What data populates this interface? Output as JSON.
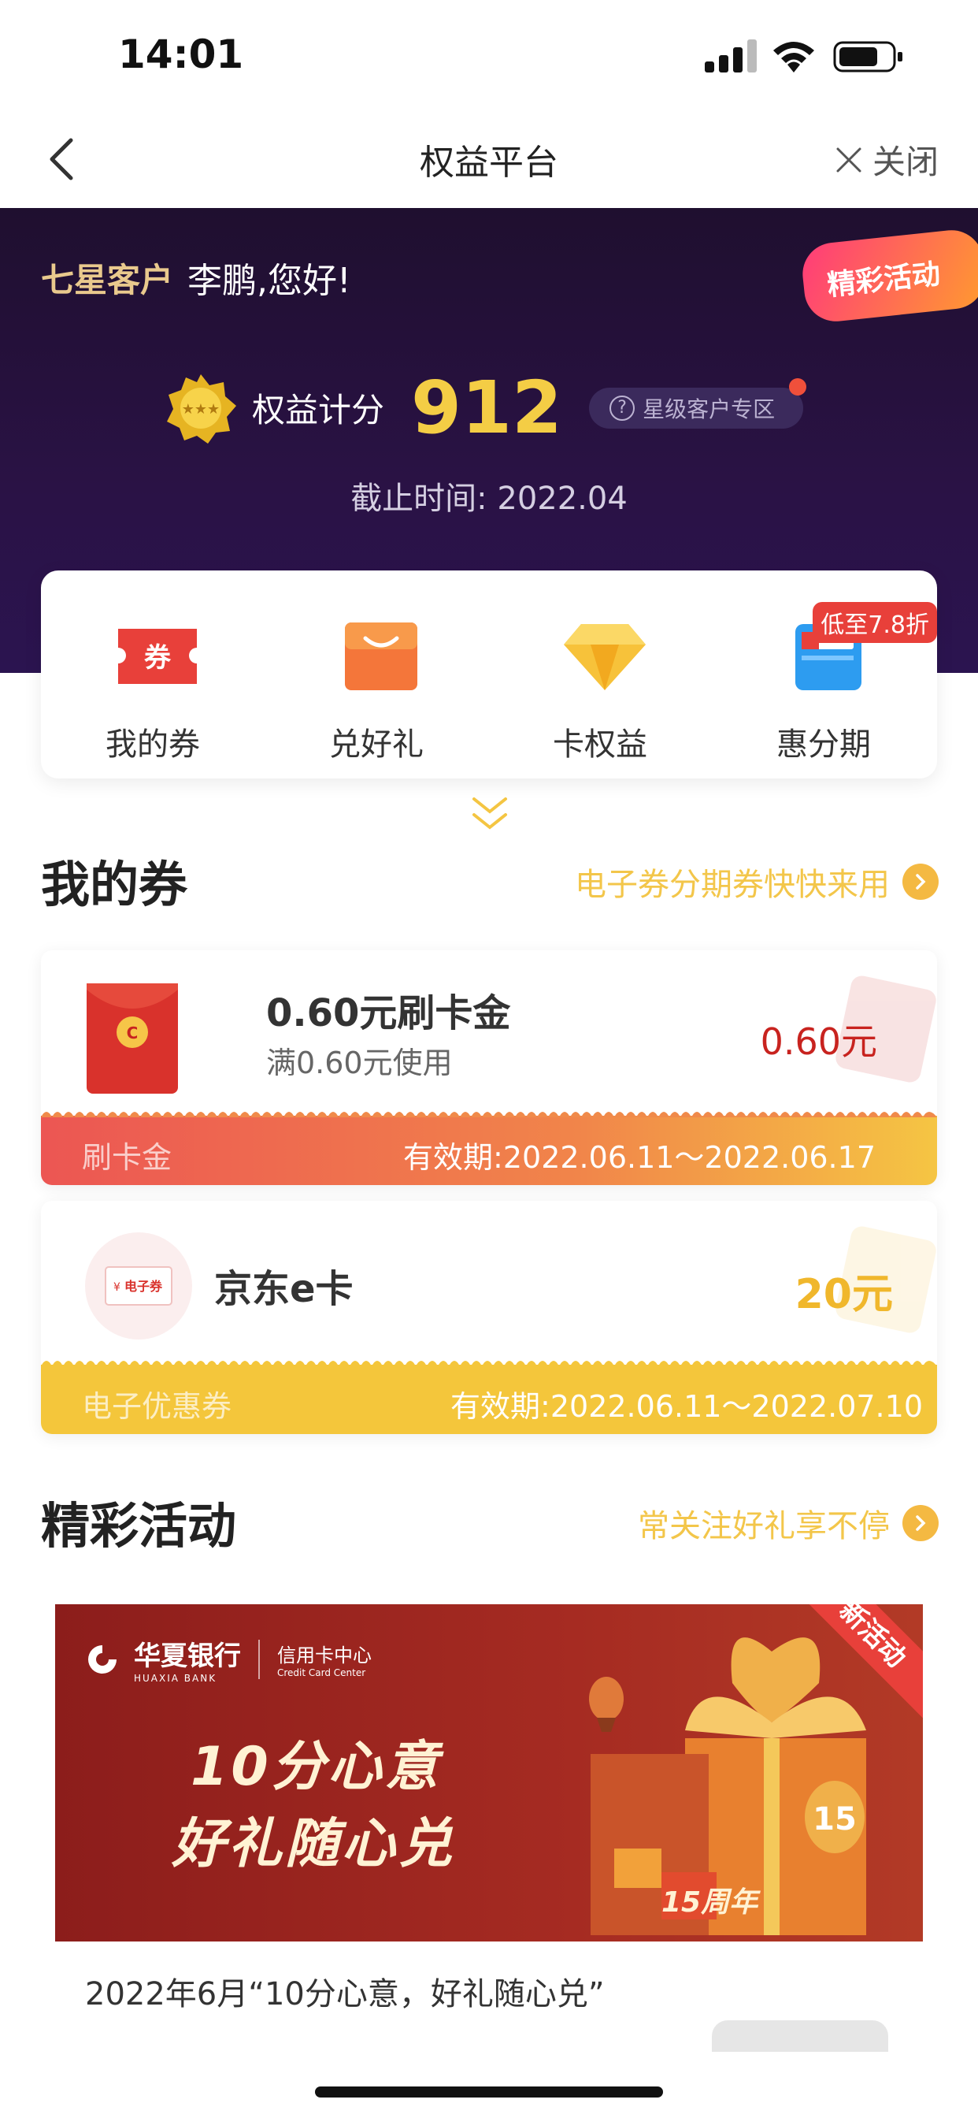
{
  "status_bar": {
    "time": "14:01"
  },
  "nav": {
    "title": "权益平台",
    "close_label": "关闭"
  },
  "header": {
    "level": "七星客户",
    "greeting": "李鹏,您好!",
    "promo_label": "精彩活动",
    "score_label": "权益计分",
    "score_value": "912",
    "star_zone_label": "星级客户专区",
    "deadline": "截止时间: 2022.04"
  },
  "quick_menu": [
    {
      "label": "我的券",
      "icon": "coupon-ticket-icon"
    },
    {
      "label": "兑好礼",
      "icon": "gift-bag-icon"
    },
    {
      "label": "卡权益",
      "icon": "diamond-icon"
    },
    {
      "label": "惠分期",
      "icon": "card-installment-icon",
      "badge": "低至7.8折"
    }
  ],
  "my_coupons": {
    "title": "我的券",
    "link": "电子券分期券快快来用",
    "items": [
      {
        "name": "0.60元刷卡金",
        "condition": "满0.60元使用",
        "amount": "0.60元",
        "type": "刷卡金",
        "validity": "有效期:2022.06.11～2022.06.17"
      },
      {
        "name": "京东e卡",
        "amount": "20元",
        "type": "电子优惠券",
        "validity": "有效期:2022.06.11～2022.07.10",
        "icon_text": "电子券"
      }
    ]
  },
  "activities": {
    "title": "精彩活动",
    "link": "常关注好礼享不停",
    "banner": {
      "bank_cn": "华夏银行",
      "bank_en": "HUAXIA BANK",
      "center_cn": "信用卡中心",
      "center_en": "Credit Card Center",
      "line1": "10分心意",
      "line2": "好礼随心兑",
      "tag": "新活动",
      "anniversary": "15周年"
    },
    "caption": "2022年6月“10分心意，好礼随心兑”"
  },
  "colors": {
    "accent_gold": "#f4cd45",
    "header_bg": "#24103a",
    "coupon_red": "#c8231f",
    "coupon_yellow": "#f4c63b"
  }
}
